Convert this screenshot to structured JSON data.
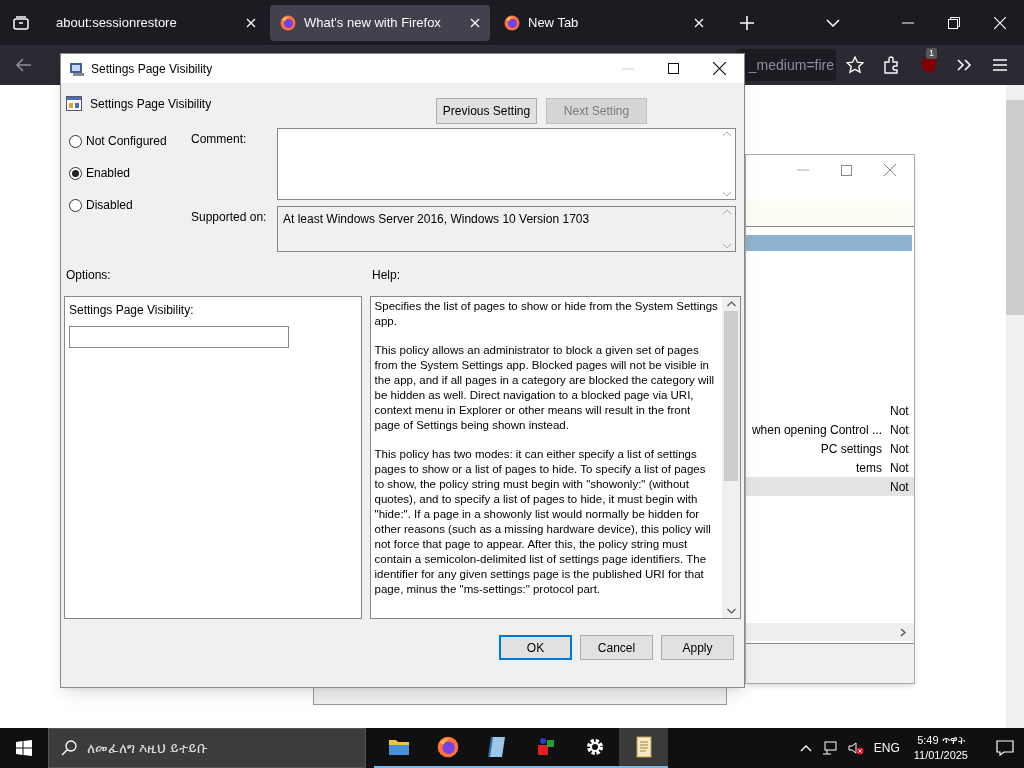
{
  "browser": {
    "tabs": [
      {
        "label": "about:sessionrestore",
        "selected": false,
        "kind": "plain"
      },
      {
        "label": "What's new with Firefox",
        "selected": true,
        "kind": "firefox"
      },
      {
        "label": "New Tab",
        "selected": false,
        "kind": "firefox"
      }
    ],
    "address_fragment": "_medium=fire",
    "extension_badge": "1"
  },
  "background_window": {
    "rows": [
      {
        "status": "Not",
        "selected": false
      },
      {
        "name": "when opening Control ...",
        "status": "Not",
        "selected": false
      },
      {
        "name": "PC settings",
        "status": "Not",
        "selected": false
      },
      {
        "name": "tems",
        "status": "Not",
        "selected": false
      },
      {
        "status": "Not",
        "selected": true
      }
    ]
  },
  "dialog": {
    "title": "Settings Page Visibility",
    "heading": "Settings Page Visibility",
    "nav_buttons": [
      {
        "label": "Previous Setting",
        "disabled": false
      },
      {
        "label": "Next Setting",
        "disabled": true
      }
    ],
    "states": [
      {
        "label": "Not Configured",
        "selected": false
      },
      {
        "label": "Enabled",
        "selected": true
      },
      {
        "label": "Disabled",
        "selected": false
      }
    ],
    "comment_label": "Comment:",
    "supported_label": "Supported on:",
    "supported_value": "At least Windows Server 2016, Windows 10 Version 1703",
    "options_label": "Options:",
    "help_label": "Help:",
    "option_field_label": "Settings Page Visibility:",
    "help_paragraphs": [
      "Specifies the list of pages to show or hide from the System Settings app.",
      "This policy allows an administrator to block a given set of pages from the System Settings app. Blocked pages will not be visible in the app, and if all pages in a category are blocked the category will be hidden as well. Direct navigation to a blocked page via URI, context menu in Explorer or other means will result in the front page of Settings being shown instead.",
      "This policy has two modes: it can either specify a list of settings pages to show or a list of pages to hide. To specify a list of pages to show, the policy string must begin with \"showonly:\" (without quotes), and to specify a list of pages to hide, it must begin with \"hide:\". If a page in a showonly list would normally be hidden for other reasons (such as a missing hardware device), this policy will not force that page to appear. After this, the policy string must contain a semicolon-delimited list of settings page identifiers. The identifier for any given settings page is the published URI for that page, minus the \"ms-settings:\" protocol part."
    ],
    "footer_buttons": [
      {
        "label": "OK",
        "default": true
      },
      {
        "label": "Cancel",
        "default": false
      },
      {
        "label": "Apply",
        "default": false
      }
    ]
  },
  "taskbar": {
    "search_placeholder": "ለመፈለግ እዚህ ይተይቡ",
    "apps": [
      {
        "kind": "folder",
        "active": false
      },
      {
        "kind": "firefox",
        "active": false
      },
      {
        "kind": "notebook",
        "active": false
      },
      {
        "kind": "shapes",
        "active": false
      },
      {
        "kind": "gear",
        "active": false
      },
      {
        "kind": "scroll",
        "active": true
      }
    ],
    "language": "ENG",
    "time": "5:49 ጥዋት",
    "date": "11/01/2025"
  }
}
